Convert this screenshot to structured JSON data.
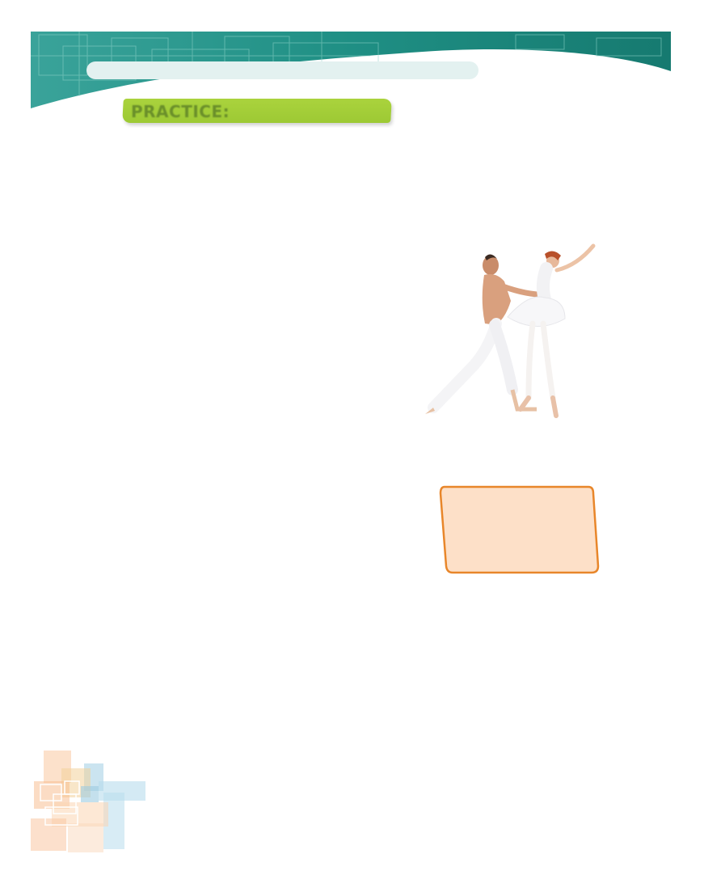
{
  "header": {
    "title": "",
    "accent_color": "#1f8f84"
  },
  "practice": {
    "label": "PRACTICE:",
    "color": "#a8d13c"
  },
  "illustration": {
    "icon": "ballet-dancers-image"
  },
  "answer_box": {
    "text": "",
    "fill": "#fde0c8",
    "border": "#e8862a"
  },
  "decoration": {
    "icon": "pastel-squares-decoration"
  }
}
